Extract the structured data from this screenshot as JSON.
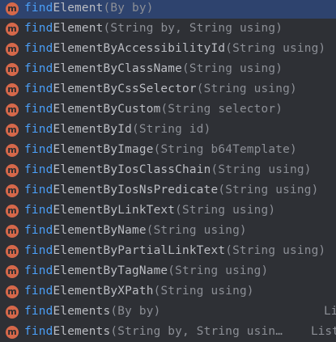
{
  "completion": {
    "query_prefix": "find",
    "badge_letter": "m",
    "items": [
      {
        "name_rest": "Element",
        "params": "(By by)",
        "return_type": ""
      },
      {
        "name_rest": "Element",
        "params": "(String by, String using)",
        "return_type": ""
      },
      {
        "name_rest": "ElementByAccessibilityId",
        "params": "(String using)",
        "return_type": ""
      },
      {
        "name_rest": "ElementByClassName",
        "params": "(String using)",
        "return_type": ""
      },
      {
        "name_rest": "ElementByCssSelector",
        "params": "(String using)",
        "return_type": ""
      },
      {
        "name_rest": "ElementByCustom",
        "params": "(String selector)",
        "return_type": ""
      },
      {
        "name_rest": "ElementById",
        "params": "(String id)",
        "return_type": ""
      },
      {
        "name_rest": "ElementByImage",
        "params": "(String b64Template)",
        "return_type": ""
      },
      {
        "name_rest": "ElementByIosClassChain",
        "params": "(String using)",
        "return_type": ""
      },
      {
        "name_rest": "ElementByIosNsPredicate",
        "params": "(String using)",
        "return_type": ""
      },
      {
        "name_rest": "ElementByLinkText",
        "params": "(String using)",
        "return_type": ""
      },
      {
        "name_rest": "ElementByName",
        "params": "(String using)",
        "return_type": ""
      },
      {
        "name_rest": "ElementByPartialLinkText",
        "params": "(String using)",
        "return_type": ""
      },
      {
        "name_rest": "ElementByTagName",
        "params": "(String using)",
        "return_type": ""
      },
      {
        "name_rest": "ElementByXPath",
        "params": "(String using)",
        "return_type": ""
      },
      {
        "name_rest": "Elements",
        "params": "(By by)",
        "return_type": "Li"
      },
      {
        "name_rest": "Elements",
        "params": "(String by, String usin…",
        "return_type": "List"
      }
    ]
  },
  "colors": {
    "background": "#2e3035",
    "selected_row": "#2e436e",
    "match_highlight": "#4b9ff8",
    "method_name": "#bcbec4",
    "params": "#8c8f96",
    "badge": "#d6684a"
  }
}
